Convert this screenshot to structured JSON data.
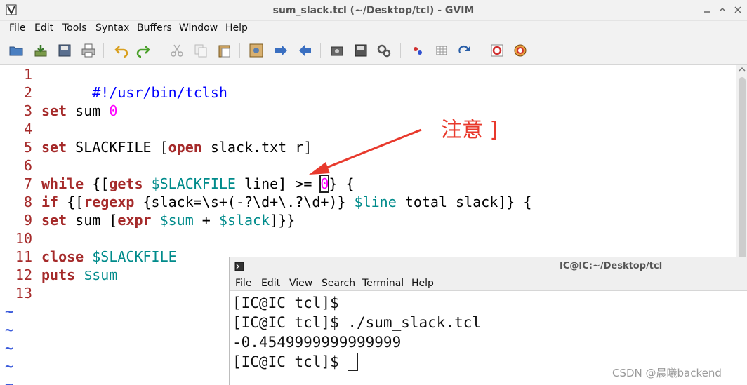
{
  "gvim": {
    "title": "sum_slack.tcl (~/Desktop/tcl) - GVIM",
    "menu": [
      "File",
      "Edit",
      "Tools",
      "Syntax",
      "Buffers",
      "Window",
      "Help"
    ],
    "toolbar_icons": [
      "open-file-icon",
      "save-download-icon",
      "save-icon",
      "print-icon",
      "undo-icon",
      "redo-icon",
      "cut-icon",
      "copy-icon",
      "paste-icon",
      "find-replace-icon",
      "forward-icon",
      "back-icon",
      "load-session-icon",
      "save-session-icon",
      "run-script-icon",
      "make-icon",
      "table-icon",
      "jump-tag-icon",
      "help-icon",
      "find-help-icon"
    ],
    "line_numbers": [
      "1",
      "2",
      "3",
      "4",
      "5",
      "6",
      "7",
      "8",
      "9",
      "10",
      "11",
      "12",
      "13"
    ],
    "tilde": "~",
    "code": {
      "l1": "#!/usr/bin/tclsh",
      "l3_set": "set",
      "l3_rest": " sum ",
      "l3_num": "0",
      "l5_set": "set",
      "l5_a": " SLACKFILE [",
      "l5_open": "open",
      "l5_b": " slack.txt r]",
      "l7_while": "while",
      "l7_a": " {[",
      "l7_gets": "gets",
      "l7_sp": " ",
      "l7_var": "$SLACKFILE",
      "l7_b": " line] >= ",
      "l7_num": "0",
      "l7_c": "} {",
      "l8_if": "if",
      "l8_a": " {[",
      "l8_regexp": "regexp",
      "l8_b": " {slack=\\s+(-?\\d+\\.?\\d+)} ",
      "l8_var": "$line",
      "l8_c": " total slack]} {",
      "l9_set": "set",
      "l9_a": " sum [",
      "l9_expr": "expr",
      "l9_sp": " ",
      "l9_var1": "$sum",
      "l9_b": " + ",
      "l9_var2": "$slack",
      "l9_c": "]}}",
      "l11_close": "close",
      "l11_sp": " ",
      "l11_var": "$SLACKFILE",
      "l12_puts": "puts",
      "l12_sp": " ",
      "l12_var": "$sum"
    },
    "annotation": "注意 ]"
  },
  "terminal": {
    "title": "IC@IC:~/Desktop/tcl",
    "menu": [
      "File",
      "Edit",
      "View",
      "Search",
      "Terminal",
      "Help"
    ],
    "lines": [
      "[IC@IC tcl]$",
      "[IC@IC tcl]$ ./sum_slack.tcl",
      "-0.4549999999999999",
      "[IC@IC tcl]$ "
    ]
  },
  "watermark": "CSDN @晨曦backend",
  "colors": {
    "keyword": "#a52a2a",
    "variable": "#008b8b",
    "number": "#ff00ff",
    "shebang": "#0000ff",
    "line_number": "#a52a2a",
    "annotation": "#e8392c"
  }
}
